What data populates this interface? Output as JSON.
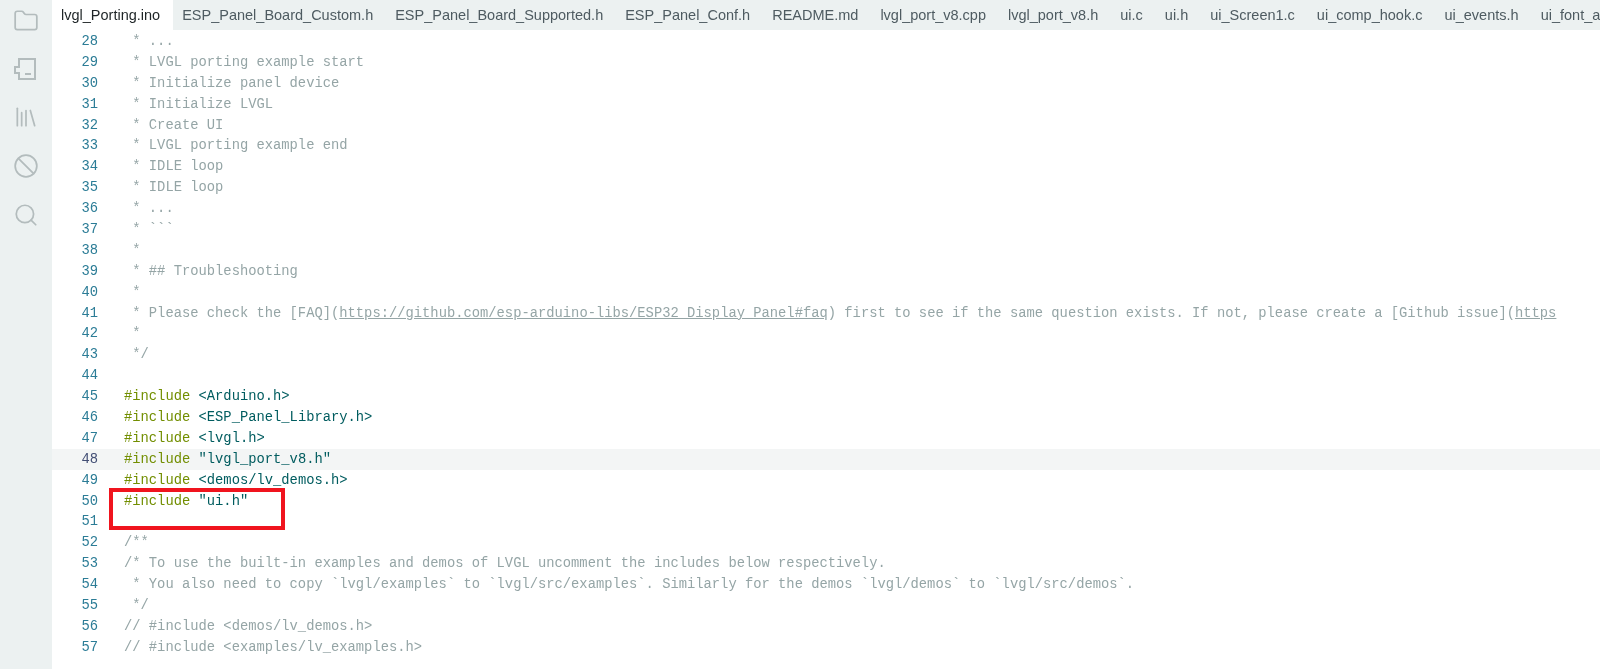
{
  "tabs": [
    {
      "label": "lvgl_Porting.ino",
      "selected": true
    },
    {
      "label": "ESP_Panel_Board_Custom.h",
      "selected": false
    },
    {
      "label": "ESP_Panel_Board_Supported.h",
      "selected": false
    },
    {
      "label": "ESP_Panel_Conf.h",
      "selected": false
    },
    {
      "label": "README.md",
      "selected": false
    },
    {
      "label": "lvgl_port_v8.cpp",
      "selected": false
    },
    {
      "label": "lvgl_port_v8.h",
      "selected": false
    },
    {
      "label": "ui.c",
      "selected": false
    },
    {
      "label": "ui.h",
      "selected": false
    },
    {
      "label": "ui_Screen1.c",
      "selected": false
    },
    {
      "label": "ui_comp_hook.c",
      "selected": false
    },
    {
      "label": "ui_events.h",
      "selected": false
    },
    {
      "label": "ui_font_a",
      "selected": false
    }
  ],
  "sidebar": {
    "items": [
      {
        "kind": "folder"
      },
      {
        "kind": "board"
      },
      {
        "kind": "library"
      },
      {
        "kind": "debug"
      },
      {
        "kind": "search"
      }
    ]
  },
  "editor": {
    "blocks": [
      {
        "kind": "line",
        "number": "28",
        "segments": [
          {
            "kind": "comment",
            "text": " * ..."
          }
        ]
      },
      {
        "kind": "line",
        "number": "29",
        "segments": [
          {
            "kind": "comment",
            "text": " * LVGL porting example start"
          }
        ]
      },
      {
        "kind": "line",
        "number": "30",
        "segments": [
          {
            "kind": "comment",
            "text": " * Initialize panel device"
          }
        ]
      },
      {
        "kind": "line",
        "number": "31",
        "segments": [
          {
            "kind": "comment",
            "text": " * Initialize LVGL"
          }
        ]
      },
      {
        "kind": "line",
        "number": "32",
        "segments": [
          {
            "kind": "comment",
            "text": " * Create UI"
          }
        ]
      },
      {
        "kind": "line",
        "number": "33",
        "segments": [
          {
            "kind": "comment",
            "text": " * LVGL porting example end"
          }
        ]
      },
      {
        "kind": "line",
        "number": "34",
        "segments": [
          {
            "kind": "comment",
            "text": " * IDLE loop"
          }
        ]
      },
      {
        "kind": "line",
        "number": "35",
        "segments": [
          {
            "kind": "comment",
            "text": " * IDLE loop"
          }
        ]
      },
      {
        "kind": "line",
        "number": "36",
        "segments": [
          {
            "kind": "comment",
            "text": " * ..."
          }
        ]
      },
      {
        "kind": "line",
        "number": "37",
        "segments": [
          {
            "kind": "comment",
            "text": " * ```"
          }
        ]
      },
      {
        "kind": "line",
        "number": "38",
        "segments": [
          {
            "kind": "comment",
            "text": " *"
          }
        ]
      },
      {
        "kind": "line",
        "number": "39",
        "segments": [
          {
            "kind": "comment",
            "text": " * ## Troubleshooting"
          }
        ]
      },
      {
        "kind": "line",
        "number": "40",
        "segments": [
          {
            "kind": "comment",
            "text": " *"
          }
        ]
      },
      {
        "kind": "line",
        "number": "41",
        "segments": [
          {
            "kind": "comment",
            "text": " * Please check the [FAQ]("
          },
          {
            "kind": "link",
            "text": "https://github.com/esp-arduino-libs/ESP32_Display_Panel#faq"
          },
          {
            "kind": "comment",
            "text": ") first to see if the same question exists. If not, please create a [Github issue]("
          },
          {
            "kind": "link",
            "text": "https"
          }
        ]
      },
      {
        "kind": "line",
        "number": "42",
        "segments": [
          {
            "kind": "comment",
            "text": " *"
          }
        ]
      },
      {
        "kind": "line",
        "number": "43",
        "segments": [
          {
            "kind": "comment",
            "text": " */"
          }
        ]
      },
      {
        "kind": "line",
        "number": "44"
      },
      {
        "kind": "line",
        "number": "45",
        "segments": [
          {
            "kind": "directive",
            "text": "#include"
          },
          {
            "kind": "header",
            "text": " <Arduino.h>"
          }
        ]
      },
      {
        "kind": "line",
        "number": "46",
        "segments": [
          {
            "kind": "directive",
            "text": "#include"
          },
          {
            "kind": "header",
            "text": " <ESP_Panel_Library.h>"
          }
        ]
      },
      {
        "kind": "line",
        "number": "47",
        "segments": [
          {
            "kind": "directive",
            "text": "#include"
          },
          {
            "kind": "header",
            "text": " <lvgl.h>"
          }
        ]
      },
      {
        "kind": "current_line",
        "number": "48",
        "segments": [
          {
            "kind": "directive",
            "text": "#include"
          },
          {
            "kind": "string",
            "text": " \"lvgl_port_v8.h\""
          }
        ]
      },
      {
        "kind": "line",
        "number": "49",
        "segments": [
          {
            "kind": "directive",
            "text": "#include"
          },
          {
            "kind": "header",
            "text": " <demos/lv_demos.h>"
          }
        ]
      },
      {
        "kind": "red_frame",
        "lines": [
          {
            "number": "50",
            "segments": [
              {
                "kind": "directive",
                "text": "#include"
              },
              {
                "kind": "string",
                "text": " \"ui.h\""
              }
            ]
          },
          {
            "number": "51"
          }
        ]
      },
      {
        "kind": "line",
        "number": "52",
        "segments": [
          {
            "kind": "comment",
            "text": "/**"
          }
        ]
      },
      {
        "kind": "line",
        "number": "53",
        "segments": [
          {
            "kind": "comment",
            "text": "/* To use the built-in examples and demos of LVGL uncomment the includes below respectively."
          }
        ]
      },
      {
        "kind": "line",
        "number": "54",
        "segments": [
          {
            "kind": "comment",
            "text": " * You also need to copy `lvgl/examples` to `lvgl/src/examples`. Similarly for the demos `lvgl/demos` to `lvgl/src/demos`."
          }
        ]
      },
      {
        "kind": "line",
        "number": "55",
        "segments": [
          {
            "kind": "comment",
            "text": " */"
          }
        ]
      },
      {
        "kind": "line",
        "number": "56",
        "segments": [
          {
            "kind": "comment",
            "text": "// #include <demos/lv_demos.h>"
          }
        ]
      },
      {
        "kind": "line",
        "number": "57",
        "segments": [
          {
            "kind": "comment",
            "text": "// #include <examples/lv_examples.h>"
          }
        ]
      }
    ]
  }
}
